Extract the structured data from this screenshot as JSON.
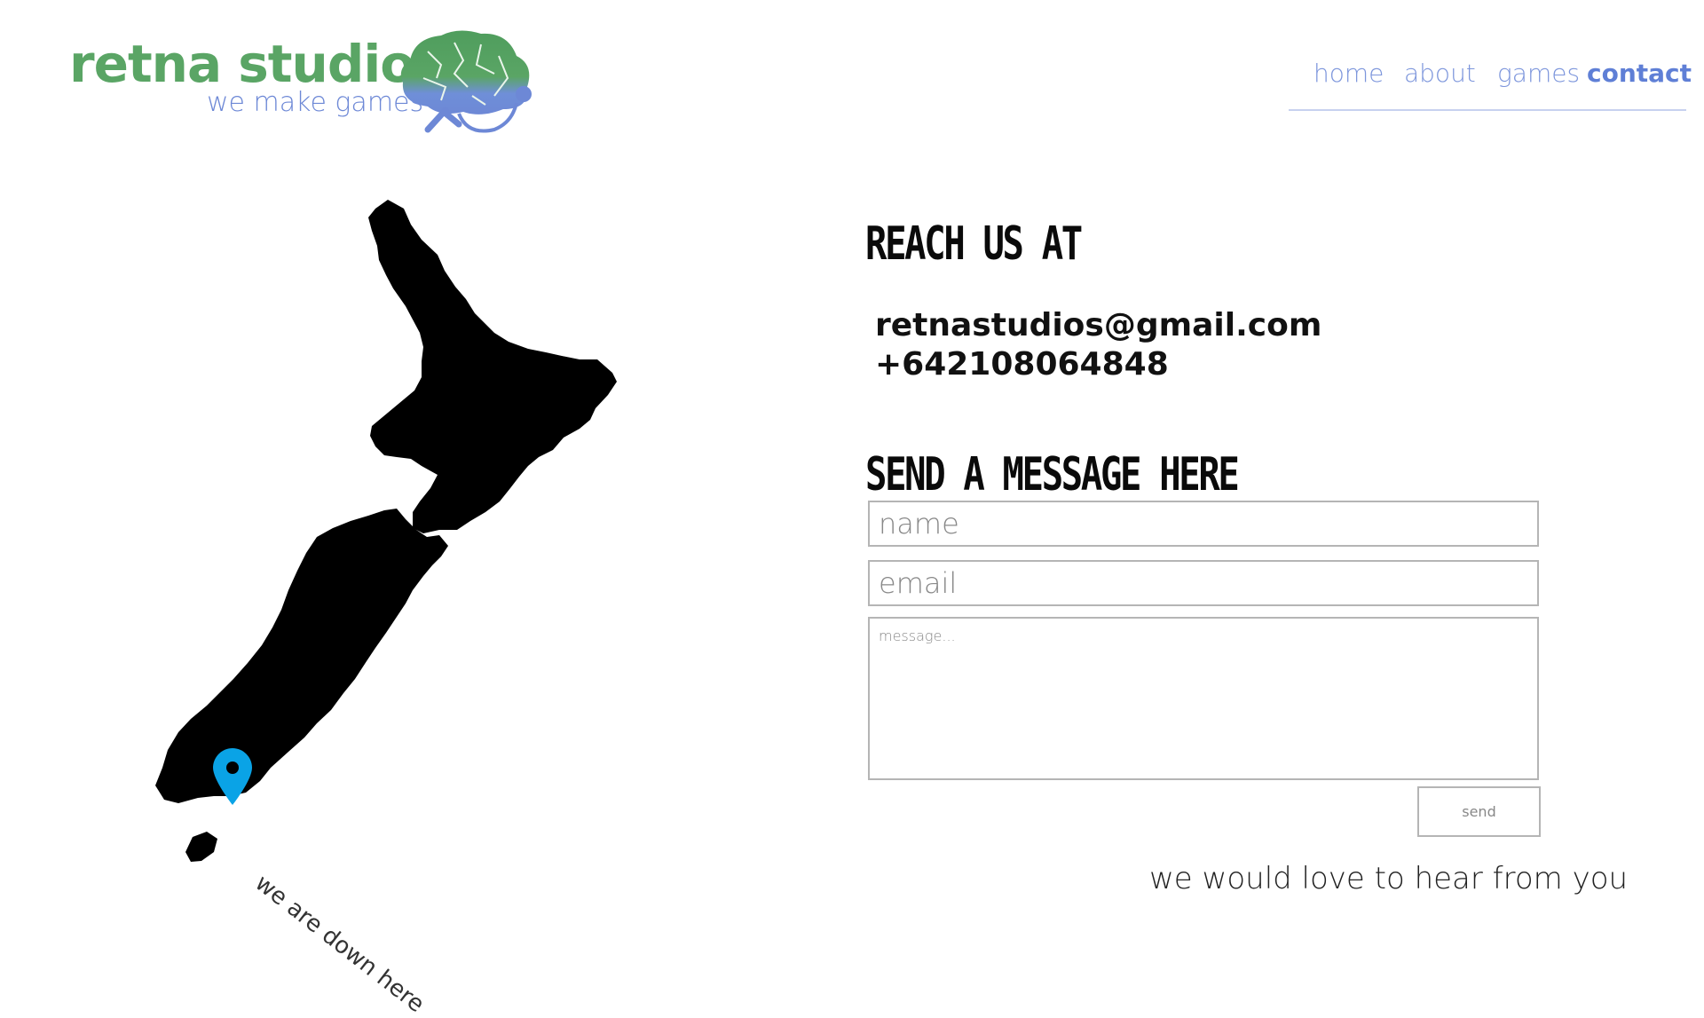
{
  "logo": {
    "title": "retna studios",
    "tagline": "we make games"
  },
  "nav": {
    "items": [
      {
        "label": "home"
      },
      {
        "label": "about"
      },
      {
        "label": "games"
      },
      {
        "label": "contact",
        "active": true
      }
    ]
  },
  "map": {
    "caption": "we are down here",
    "pin_color": "#0aa3e6"
  },
  "contact": {
    "reach_heading": "REACH US AT",
    "email": "retnastudios@gmail.com",
    "phone": "+642108064848",
    "form_heading": "SEND A MESSAGE HERE",
    "name_placeholder": "name",
    "email_placeholder": "email",
    "message_placeholder": "message...",
    "send_label": "send",
    "footer_note": "we would love to hear from you"
  },
  "colors": {
    "brand_green": "#5aa565",
    "brand_blue": "#6d88d6",
    "nav_blue": "#7d96dc"
  }
}
